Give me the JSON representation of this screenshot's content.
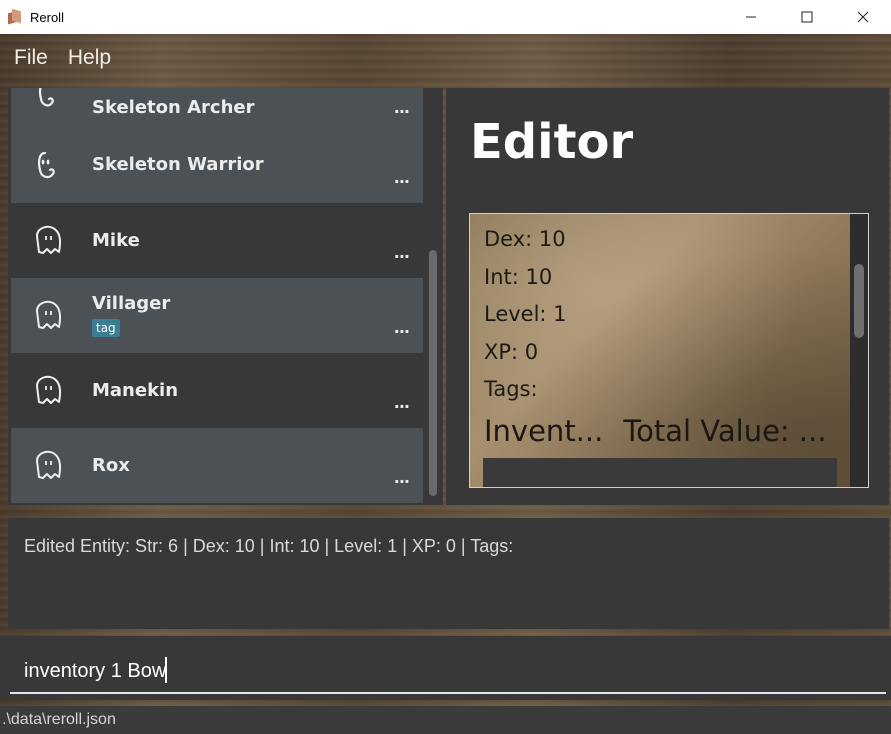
{
  "window": {
    "title": "Reroll",
    "icon": "reroll-app-icon",
    "controls": [
      "minimize-icon",
      "maximize-icon",
      "close-icon"
    ]
  },
  "menu": {
    "file": "File",
    "help": "Help"
  },
  "entity_list": {
    "items": [
      {
        "name": "Skeleton Archer",
        "icon": "skeleton-icon",
        "tag": null,
        "more": "..."
      },
      {
        "name": "Skeleton Warrior",
        "icon": "skeleton-icon",
        "tag": null,
        "more": "..."
      },
      {
        "name": "Mike",
        "icon": "ghost-icon",
        "tag": null,
        "more": "..."
      },
      {
        "name": "Villager",
        "icon": "ghost-icon",
        "tag": "tag",
        "more": "..."
      },
      {
        "name": "Manekin",
        "icon": "ghost-icon",
        "tag": null,
        "more": "..."
      },
      {
        "name": "Rox",
        "icon": "ghost-icon",
        "tag": null,
        "more": "..."
      }
    ]
  },
  "editor": {
    "title": "Editor",
    "stats": {
      "dex": "Dex: 10",
      "int": "Int: 10",
      "level": "Level: 1",
      "xp": "XP: 0",
      "tags": "Tags:"
    },
    "inventory_label": "Invent...",
    "total_value_label": "Total Value: ..."
  },
  "result": {
    "text": "Edited Entity: Str: 6 | Dex: 10 | Int: 10 | Level: 1 | XP: 0 | Tags:"
  },
  "command": {
    "value": "inventory 1 Bow"
  },
  "status": {
    "path": ".\\data\\reroll.json"
  }
}
